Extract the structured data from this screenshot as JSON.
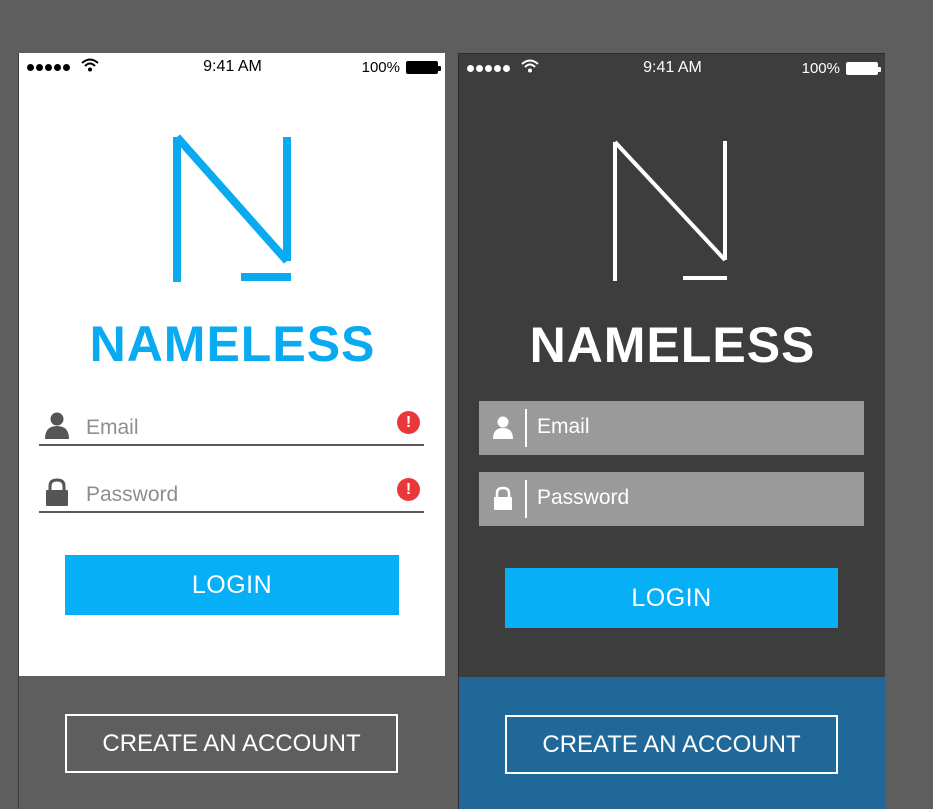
{
  "screens": [
    {
      "theme": "light",
      "status": {
        "time": "9:41 AM",
        "battery": "100%"
      },
      "brand": "NAMELESS",
      "email_placeholder": "Email",
      "password_placeholder": "Password",
      "email_error_glyph": "!",
      "password_error_glyph": "!",
      "login_label": "LOGIN",
      "create_label": "CREATE AN ACCOUNT"
    },
    {
      "theme": "dark",
      "status": {
        "time": "9:41 AM",
        "battery": "100%"
      },
      "brand": "NAMELESS",
      "email_placeholder": "Email",
      "password_placeholder": "Password",
      "login_label": "LOGIN",
      "create_label": "CREATE AN ACCOUNT"
    }
  ],
  "colors": {
    "accent": "#07b0f6",
    "logo_light": "#0aaaf0",
    "error": "#e8383c",
    "dark_bg": "#3d3d3d",
    "dark_footer": "#1f6898",
    "canvas": "#5e5e5e"
  },
  "icons": [
    "signal-dots-icon",
    "wifi-icon",
    "battery-icon",
    "user-icon",
    "lock-icon",
    "error-icon",
    "n-logo-icon"
  ]
}
